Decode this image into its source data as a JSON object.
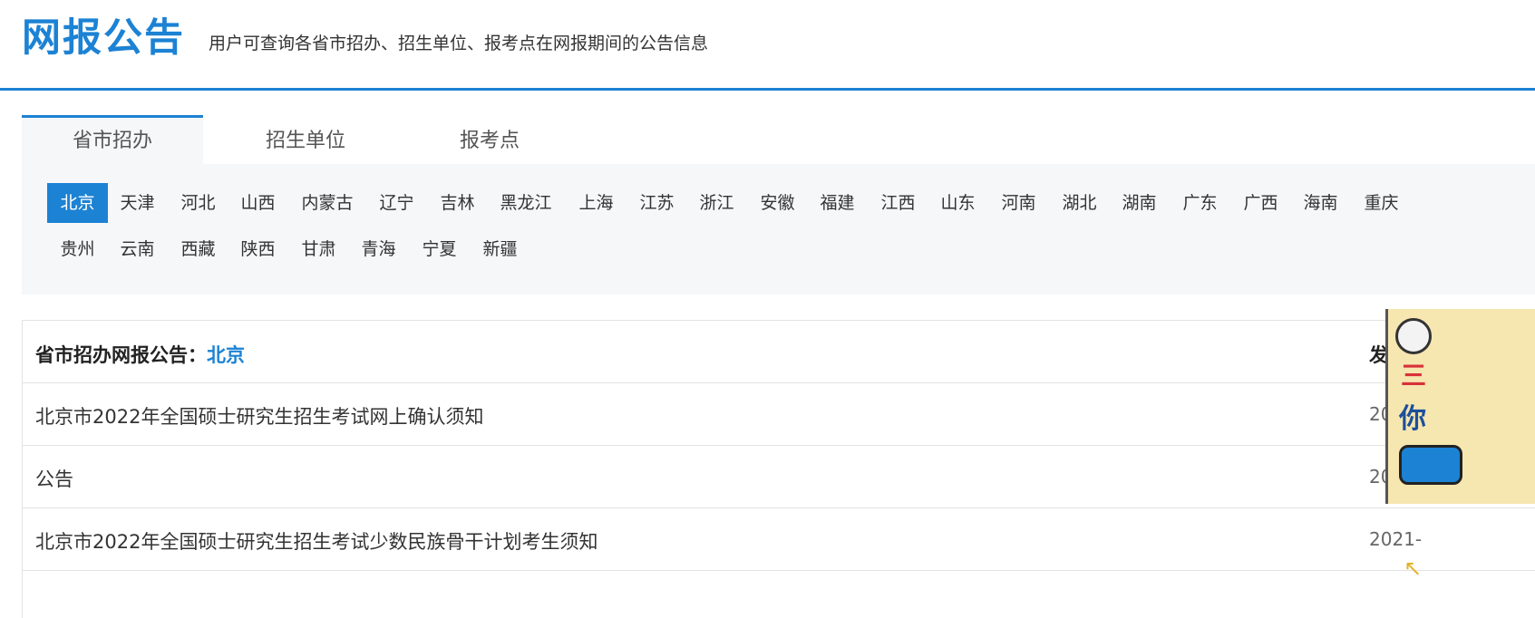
{
  "header": {
    "title": "网报公告",
    "subtitle": "用户可查询各省市招办、招生单位、报考点在网报期间的公告信息"
  },
  "tabs": [
    {
      "label": "省市招办",
      "active": true
    },
    {
      "label": "招生单位",
      "active": false
    },
    {
      "label": "报考点",
      "active": false
    }
  ],
  "regions": [
    {
      "label": "北京",
      "active": true
    },
    {
      "label": "天津"
    },
    {
      "label": "河北"
    },
    {
      "label": "山西"
    },
    {
      "label": "内蒙古"
    },
    {
      "label": "辽宁"
    },
    {
      "label": "吉林"
    },
    {
      "label": "黑龙江"
    },
    {
      "label": "上海"
    },
    {
      "label": "江苏"
    },
    {
      "label": "浙江"
    },
    {
      "label": "安徽"
    },
    {
      "label": "福建"
    },
    {
      "label": "江西"
    },
    {
      "label": "山东"
    },
    {
      "label": "河南"
    },
    {
      "label": "湖北"
    },
    {
      "label": "湖南"
    },
    {
      "label": "广东"
    },
    {
      "label": "广西"
    },
    {
      "label": "海南"
    },
    {
      "label": "重庆"
    },
    {
      "label": "贵州"
    },
    {
      "label": "云南"
    },
    {
      "label": "西藏"
    },
    {
      "label": "陕西"
    },
    {
      "label": "甘肃"
    },
    {
      "label": "青海"
    },
    {
      "label": "宁夏"
    },
    {
      "label": "新疆"
    }
  ],
  "list": {
    "heading_label": "省市招办网报公告：",
    "heading_city": "北京",
    "date_column_label": "发",
    "items": [
      {
        "title": "北京市2022年全国硕士研究生招生考试网上确认须知",
        "date": "20"
      },
      {
        "title": "公告",
        "date": "20"
      },
      {
        "title": "北京市2022年全国硕士研究生招生考试少数民族骨干计划考生须知",
        "date": "2021-"
      }
    ]
  },
  "ad": {
    "red_text": "三",
    "text": "你",
    "accent_color": "#1c82d4"
  }
}
